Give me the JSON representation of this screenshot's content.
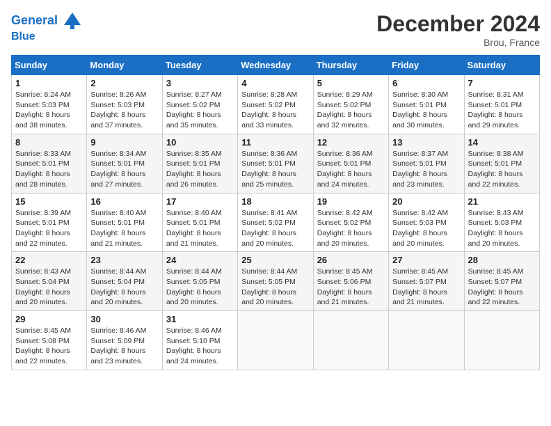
{
  "header": {
    "logo_line1": "General",
    "logo_line2": "Blue",
    "month_title": "December 2024",
    "location": "Brou, France"
  },
  "weekdays": [
    "Sunday",
    "Monday",
    "Tuesday",
    "Wednesday",
    "Thursday",
    "Friday",
    "Saturday"
  ],
  "weeks": [
    [
      {
        "day": "1",
        "sunrise": "8:24 AM",
        "sunset": "5:03 PM",
        "daylight": "8 hours and 38 minutes."
      },
      {
        "day": "2",
        "sunrise": "8:26 AM",
        "sunset": "5:03 PM",
        "daylight": "8 hours and 37 minutes."
      },
      {
        "day": "3",
        "sunrise": "8:27 AM",
        "sunset": "5:02 PM",
        "daylight": "8 hours and 35 minutes."
      },
      {
        "day": "4",
        "sunrise": "8:28 AM",
        "sunset": "5:02 PM",
        "daylight": "8 hours and 33 minutes."
      },
      {
        "day": "5",
        "sunrise": "8:29 AM",
        "sunset": "5:02 PM",
        "daylight": "8 hours and 32 minutes."
      },
      {
        "day": "6",
        "sunrise": "8:30 AM",
        "sunset": "5:01 PM",
        "daylight": "8 hours and 30 minutes."
      },
      {
        "day": "7",
        "sunrise": "8:31 AM",
        "sunset": "5:01 PM",
        "daylight": "8 hours and 29 minutes."
      }
    ],
    [
      {
        "day": "8",
        "sunrise": "8:33 AM",
        "sunset": "5:01 PM",
        "daylight": "8 hours and 28 minutes."
      },
      {
        "day": "9",
        "sunrise": "8:34 AM",
        "sunset": "5:01 PM",
        "daylight": "8 hours and 27 minutes."
      },
      {
        "day": "10",
        "sunrise": "8:35 AM",
        "sunset": "5:01 PM",
        "daylight": "8 hours and 26 minutes."
      },
      {
        "day": "11",
        "sunrise": "8:36 AM",
        "sunset": "5:01 PM",
        "daylight": "8 hours and 25 minutes."
      },
      {
        "day": "12",
        "sunrise": "8:36 AM",
        "sunset": "5:01 PM",
        "daylight": "8 hours and 24 minutes."
      },
      {
        "day": "13",
        "sunrise": "8:37 AM",
        "sunset": "5:01 PM",
        "daylight": "8 hours and 23 minutes."
      },
      {
        "day": "14",
        "sunrise": "8:38 AM",
        "sunset": "5:01 PM",
        "daylight": "8 hours and 22 minutes."
      }
    ],
    [
      {
        "day": "15",
        "sunrise": "8:39 AM",
        "sunset": "5:01 PM",
        "daylight": "8 hours and 22 minutes."
      },
      {
        "day": "16",
        "sunrise": "8:40 AM",
        "sunset": "5:01 PM",
        "daylight": "8 hours and 21 minutes."
      },
      {
        "day": "17",
        "sunrise": "8:40 AM",
        "sunset": "5:01 PM",
        "daylight": "8 hours and 21 minutes."
      },
      {
        "day": "18",
        "sunrise": "8:41 AM",
        "sunset": "5:02 PM",
        "daylight": "8 hours and 20 minutes."
      },
      {
        "day": "19",
        "sunrise": "8:42 AM",
        "sunset": "5:02 PM",
        "daylight": "8 hours and 20 minutes."
      },
      {
        "day": "20",
        "sunrise": "8:42 AM",
        "sunset": "5:03 PM",
        "daylight": "8 hours and 20 minutes."
      },
      {
        "day": "21",
        "sunrise": "8:43 AM",
        "sunset": "5:03 PM",
        "daylight": "8 hours and 20 minutes."
      }
    ],
    [
      {
        "day": "22",
        "sunrise": "8:43 AM",
        "sunset": "5:04 PM",
        "daylight": "8 hours and 20 minutes."
      },
      {
        "day": "23",
        "sunrise": "8:44 AM",
        "sunset": "5:04 PM",
        "daylight": "8 hours and 20 minutes."
      },
      {
        "day": "24",
        "sunrise": "8:44 AM",
        "sunset": "5:05 PM",
        "daylight": "8 hours and 20 minutes."
      },
      {
        "day": "25",
        "sunrise": "8:44 AM",
        "sunset": "5:05 PM",
        "daylight": "8 hours and 20 minutes."
      },
      {
        "day": "26",
        "sunrise": "8:45 AM",
        "sunset": "5:06 PM",
        "daylight": "8 hours and 21 minutes."
      },
      {
        "day": "27",
        "sunrise": "8:45 AM",
        "sunset": "5:07 PM",
        "daylight": "8 hours and 21 minutes."
      },
      {
        "day": "28",
        "sunrise": "8:45 AM",
        "sunset": "5:07 PM",
        "daylight": "8 hours and 22 minutes."
      }
    ],
    [
      {
        "day": "29",
        "sunrise": "8:45 AM",
        "sunset": "5:08 PM",
        "daylight": "8 hours and 22 minutes."
      },
      {
        "day": "30",
        "sunrise": "8:46 AM",
        "sunset": "5:09 PM",
        "daylight": "8 hours and 23 minutes."
      },
      {
        "day": "31",
        "sunrise": "8:46 AM",
        "sunset": "5:10 PM",
        "daylight": "8 hours and 24 minutes."
      },
      null,
      null,
      null,
      null
    ]
  ],
  "labels": {
    "sunrise_prefix": "Sunrise: ",
    "sunset_prefix": "Sunset: ",
    "daylight_prefix": "Daylight: "
  }
}
